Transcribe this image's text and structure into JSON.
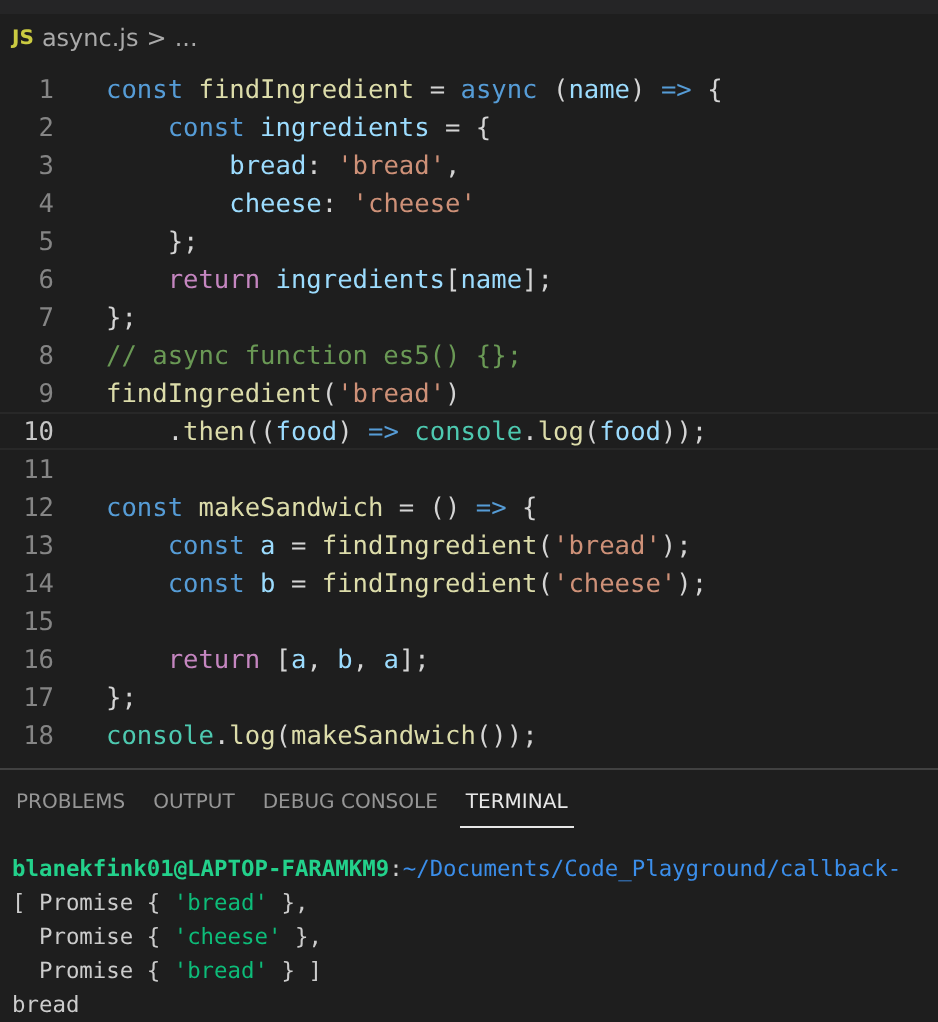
{
  "breadcrumb": {
    "file_icon": "JS",
    "file": "async.js",
    "separator": ">",
    "more": "..."
  },
  "editor": {
    "lines": [
      {
        "number": "1",
        "current": false,
        "tokens": [
          {
            "kind": "keyword",
            "text": "const "
          },
          {
            "kind": "function",
            "text": "findIngredient"
          },
          {
            "kind": "punct",
            "text": " = "
          },
          {
            "kind": "keyword",
            "text": "async"
          },
          {
            "kind": "punct",
            "text": " ("
          },
          {
            "kind": "variable",
            "text": "name"
          },
          {
            "kind": "punct",
            "text": ") "
          },
          {
            "kind": "keyword",
            "text": "=>"
          },
          {
            "kind": "punct",
            "text": " {"
          }
        ]
      },
      {
        "number": "2",
        "current": false,
        "tokens": [
          {
            "kind": "keyword",
            "text": "    const "
          },
          {
            "kind": "variable",
            "text": "ingredients"
          },
          {
            "kind": "punct",
            "text": " = {"
          }
        ]
      },
      {
        "number": "3",
        "current": false,
        "tokens": [
          {
            "kind": "variable",
            "text": "        bread"
          },
          {
            "kind": "punct",
            "text": ": "
          },
          {
            "kind": "string",
            "text": "'bread'"
          },
          {
            "kind": "punct",
            "text": ","
          }
        ]
      },
      {
        "number": "4",
        "current": false,
        "tokens": [
          {
            "kind": "variable",
            "text": "        cheese"
          },
          {
            "kind": "punct",
            "text": ": "
          },
          {
            "kind": "string",
            "text": "'cheese'"
          }
        ]
      },
      {
        "number": "5",
        "current": false,
        "tokens": [
          {
            "kind": "punct",
            "text": "    };"
          }
        ]
      },
      {
        "number": "6",
        "current": false,
        "tokens": [
          {
            "kind": "control",
            "text": "    return "
          },
          {
            "kind": "variable",
            "text": "ingredients"
          },
          {
            "kind": "punct",
            "text": "["
          },
          {
            "kind": "variable",
            "text": "name"
          },
          {
            "kind": "punct",
            "text": "];"
          }
        ]
      },
      {
        "number": "7",
        "current": false,
        "tokens": [
          {
            "kind": "punct",
            "text": "};"
          }
        ]
      },
      {
        "number": "8",
        "current": false,
        "tokens": [
          {
            "kind": "comment",
            "text": "// async function es5() {};"
          }
        ]
      },
      {
        "number": "9",
        "current": false,
        "tokens": [
          {
            "kind": "function",
            "text": "findIngredient"
          },
          {
            "kind": "punct",
            "text": "("
          },
          {
            "kind": "string",
            "text": "'bread'"
          },
          {
            "kind": "punct",
            "text": ")"
          }
        ]
      },
      {
        "number": "10",
        "current": true,
        "tokens": [
          {
            "kind": "punct",
            "text": "    ."
          },
          {
            "kind": "function",
            "text": "then"
          },
          {
            "kind": "punct",
            "text": "(("
          },
          {
            "kind": "variable",
            "text": "food"
          },
          {
            "kind": "punct",
            "text": ") "
          },
          {
            "kind": "keyword",
            "text": "=> "
          },
          {
            "kind": "class",
            "text": "console"
          },
          {
            "kind": "punct",
            "text": "."
          },
          {
            "kind": "function",
            "text": "log"
          },
          {
            "kind": "punct",
            "text": "("
          },
          {
            "kind": "variable",
            "text": "food"
          },
          {
            "kind": "punct",
            "text": "));"
          }
        ]
      },
      {
        "number": "11",
        "current": false
      },
      {
        "number": "12",
        "current": false,
        "tokens": [
          {
            "kind": "keyword",
            "text": "const "
          },
          {
            "kind": "function",
            "text": "makeSandwich"
          },
          {
            "kind": "punct",
            "text": " = () "
          },
          {
            "kind": "keyword",
            "text": "=>"
          },
          {
            "kind": "punct",
            "text": " {"
          }
        ]
      },
      {
        "number": "13",
        "current": false,
        "tokens": [
          {
            "kind": "keyword",
            "text": "    const "
          },
          {
            "kind": "variable",
            "text": "a"
          },
          {
            "kind": "punct",
            "text": " = "
          },
          {
            "kind": "function",
            "text": "findIngredient"
          },
          {
            "kind": "punct",
            "text": "("
          },
          {
            "kind": "string",
            "text": "'bread'"
          },
          {
            "kind": "punct",
            "text": ");"
          }
        ]
      },
      {
        "number": "14",
        "current": false,
        "tokens": [
          {
            "kind": "keyword",
            "text": "    const "
          },
          {
            "kind": "variable",
            "text": "b"
          },
          {
            "kind": "punct",
            "text": " = "
          },
          {
            "kind": "function",
            "text": "findIngredient"
          },
          {
            "kind": "punct",
            "text": "("
          },
          {
            "kind": "string",
            "text": "'cheese'"
          },
          {
            "kind": "punct",
            "text": ");"
          }
        ]
      },
      {
        "number": "15",
        "current": false
      },
      {
        "number": "16",
        "current": false,
        "tokens": [
          {
            "kind": "control",
            "text": "    return "
          },
          {
            "kind": "punct",
            "text": "["
          },
          {
            "kind": "variable",
            "text": "a"
          },
          {
            "kind": "punct",
            "text": ", "
          },
          {
            "kind": "variable",
            "text": "b"
          },
          {
            "kind": "punct",
            "text": ", "
          },
          {
            "kind": "variable",
            "text": "a"
          },
          {
            "kind": "punct",
            "text": "];"
          }
        ]
      },
      {
        "number": "17",
        "current": false,
        "tokens": [
          {
            "kind": "punct",
            "text": "};"
          }
        ]
      },
      {
        "number": "18",
        "current": false,
        "tokens": [
          {
            "kind": "class",
            "text": "console"
          },
          {
            "kind": "punct",
            "text": "."
          },
          {
            "kind": "function",
            "text": "log"
          },
          {
            "kind": "punct",
            "text": "("
          },
          {
            "kind": "function",
            "text": "makeSandwich"
          },
          {
            "kind": "punct",
            "text": "());"
          }
        ]
      }
    ]
  },
  "panel": {
    "tabs": [
      {
        "label": "PROBLEMS",
        "selected": false
      },
      {
        "label": "OUTPUT",
        "selected": false
      },
      {
        "label": "DEBUG CONSOLE",
        "selected": false
      },
      {
        "label": "TERMINAL",
        "selected": true
      }
    ],
    "terminal_lines": [
      [
        {
          "kind": "user",
          "text": "blanekfink01@LAPTOP-FARAMKM9"
        },
        {
          "kind": "plain",
          "text": ":"
        },
        {
          "kind": "path",
          "text": "~/Documents/Code_Playground/callback-"
        }
      ],
      [
        {
          "kind": "plain",
          "text": "[ Promise { "
        },
        {
          "kind": "string",
          "text": "'bread'"
        },
        {
          "kind": "plain",
          "text": " },"
        }
      ],
      [
        {
          "kind": "plain",
          "text": "  Promise { "
        },
        {
          "kind": "string",
          "text": "'cheese'"
        },
        {
          "kind": "plain",
          "text": " },"
        }
      ],
      [
        {
          "kind": "plain",
          "text": "  Promise { "
        },
        {
          "kind": "string",
          "text": "'bread'"
        },
        {
          "kind": "plain",
          "text": " } ]"
        }
      ],
      [
        {
          "kind": "plain",
          "text": "bread"
        }
      ]
    ]
  }
}
